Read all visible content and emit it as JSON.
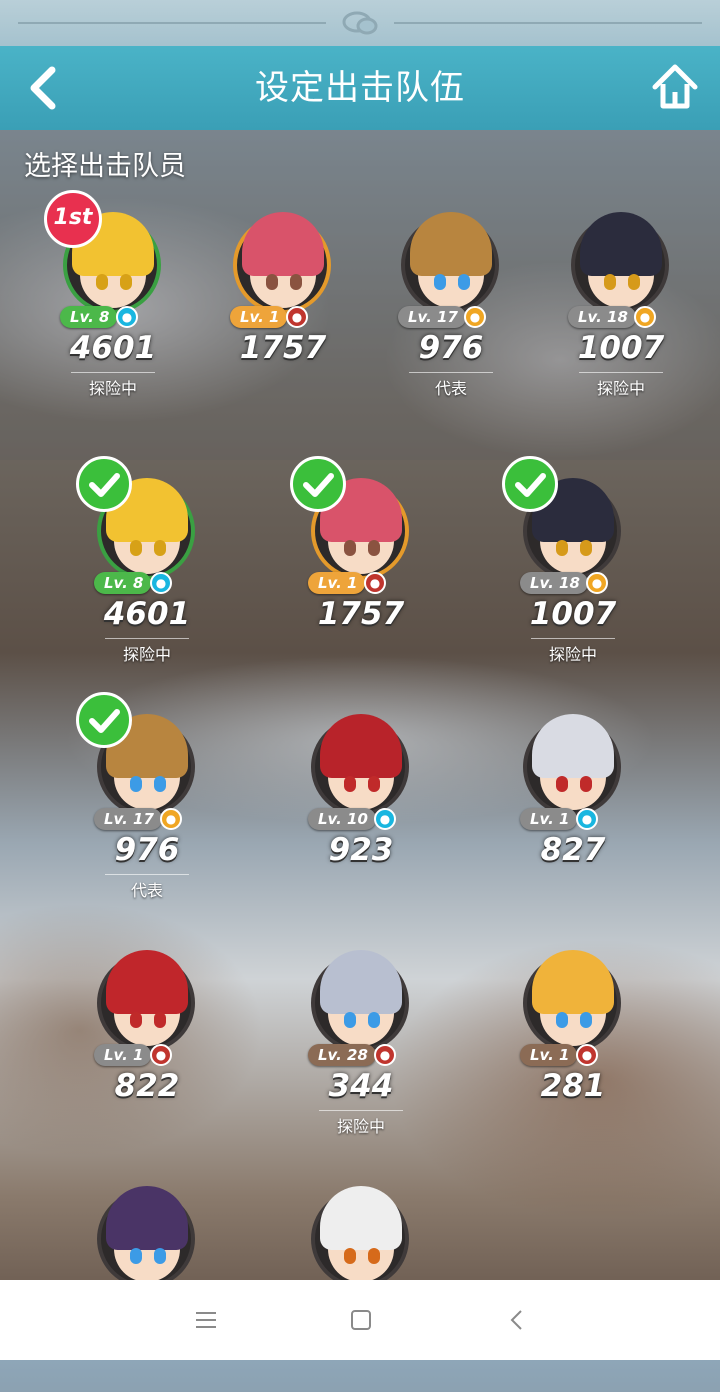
{
  "header": {
    "title": "设定出击队伍"
  },
  "section": {
    "subtitle": "选择出击队员"
  },
  "icons": {
    "back": "chevron-left-icon",
    "home": "home-icon",
    "chat": "chat-bubble-icon",
    "check": "check-icon"
  },
  "roster_top": [
    {
      "level": "Lv. 8",
      "power": "4601",
      "status": "探险中",
      "rank": "1st",
      "hair": "#f2c231",
      "ring": "#3aa042",
      "pill": "#4cb84a",
      "type": "#19b6e0",
      "eye": "#d7a117"
    },
    {
      "level": "Lv. 1",
      "power": "1757",
      "status": "",
      "hair": "#d9536a",
      "ring": "#e49a2b",
      "pill": "#eea43a",
      "type": "#c0352e",
      "eye": "#8a5340"
    },
    {
      "level": "Lv. 17",
      "power": "976",
      "status": "代表",
      "hair": "#b8853f",
      "ring": "#3f3a3a",
      "pill": "#8b8b8b",
      "type": "#f0a623",
      "eye": "#3c9be6"
    },
    {
      "level": "Lv. 18",
      "power": "1007",
      "status": "探险中",
      "hair": "#2b2c3d",
      "ring": "#3f3a3a",
      "pill": "#8b8b8b",
      "type": "#f0a623",
      "eye": "#d69a1a"
    }
  ],
  "roster_selected": [
    {
      "level": "Lv. 8",
      "power": "4601",
      "status": "探险中",
      "hair": "#f2c231",
      "ring": "#3aa042",
      "pill": "#4cb84a",
      "type": "#19b6e0",
      "eye": "#d7a117",
      "checked": true
    },
    {
      "level": "Lv. 1",
      "power": "1757",
      "status": "",
      "hair": "#d9536a",
      "ring": "#e49a2b",
      "pill": "#eea43a",
      "type": "#c0352e",
      "eye": "#8a5340",
      "checked": true
    },
    {
      "level": "Lv. 18",
      "power": "1007",
      "status": "探险中",
      "hair": "#2b2c3d",
      "ring": "#3f3a3a",
      "pill": "#8b8b8b",
      "type": "#f0a623",
      "eye": "#d69a1a",
      "checked": true
    },
    {
      "level": "Lv. 17",
      "power": "976",
      "status": "代表",
      "hair": "#b8853f",
      "ring": "#3f3a3a",
      "pill": "#8b8b8b",
      "type": "#f0a623",
      "eye": "#3c9be6",
      "checked": true
    },
    {
      "level": "Lv. 10",
      "power": "923",
      "status": "",
      "hair": "#b8232a",
      "ring": "#3f3a3a",
      "pill": "#8b8b8b",
      "type": "#19b6e0",
      "eye": "#c02a2a"
    },
    {
      "level": "Lv. 1",
      "power": "827",
      "status": "",
      "hair": "#d9dbe3",
      "ring": "#3f3a3a",
      "pill": "#8b8b8b",
      "type": "#19b6e0",
      "eye": "#c02a2a"
    },
    {
      "level": "Lv. 1",
      "power": "822",
      "status": "",
      "hair": "#c0262b",
      "ring": "#3f3a3a",
      "pill": "#8b8b8b",
      "type": "#c0352e",
      "eye": "#c02a2a"
    },
    {
      "level": "Lv. 28",
      "power": "344",
      "status": "探险中",
      "hair": "#b8bfd0",
      "ring": "#3f3a3a",
      "pill": "#8b6b55",
      "type": "#c0352e",
      "eye": "#3c9be6"
    },
    {
      "level": "Lv. 1",
      "power": "281",
      "status": "",
      "hair": "#f0b33a",
      "ring": "#3f3a3a",
      "pill": "#8b6b55",
      "type": "#c0352e",
      "eye": "#3c9be6"
    },
    {
      "level": "",
      "power": "",
      "status": "",
      "hair": "#4a3466",
      "ring": "#3f3a3a",
      "pill": "#8b8b8b",
      "type": "#8b8b8b",
      "eye": "#3c9be6"
    },
    {
      "level": "",
      "power": "",
      "status": "",
      "hair": "#eeeeee",
      "ring": "#3f3a3a",
      "pill": "#8b8b8b",
      "type": "#8b8b8b",
      "eye": "#d66a1a"
    }
  ],
  "navbar": {
    "buttons": [
      "menu-icon",
      "square-home-icon",
      "back-triangle-icon"
    ]
  }
}
